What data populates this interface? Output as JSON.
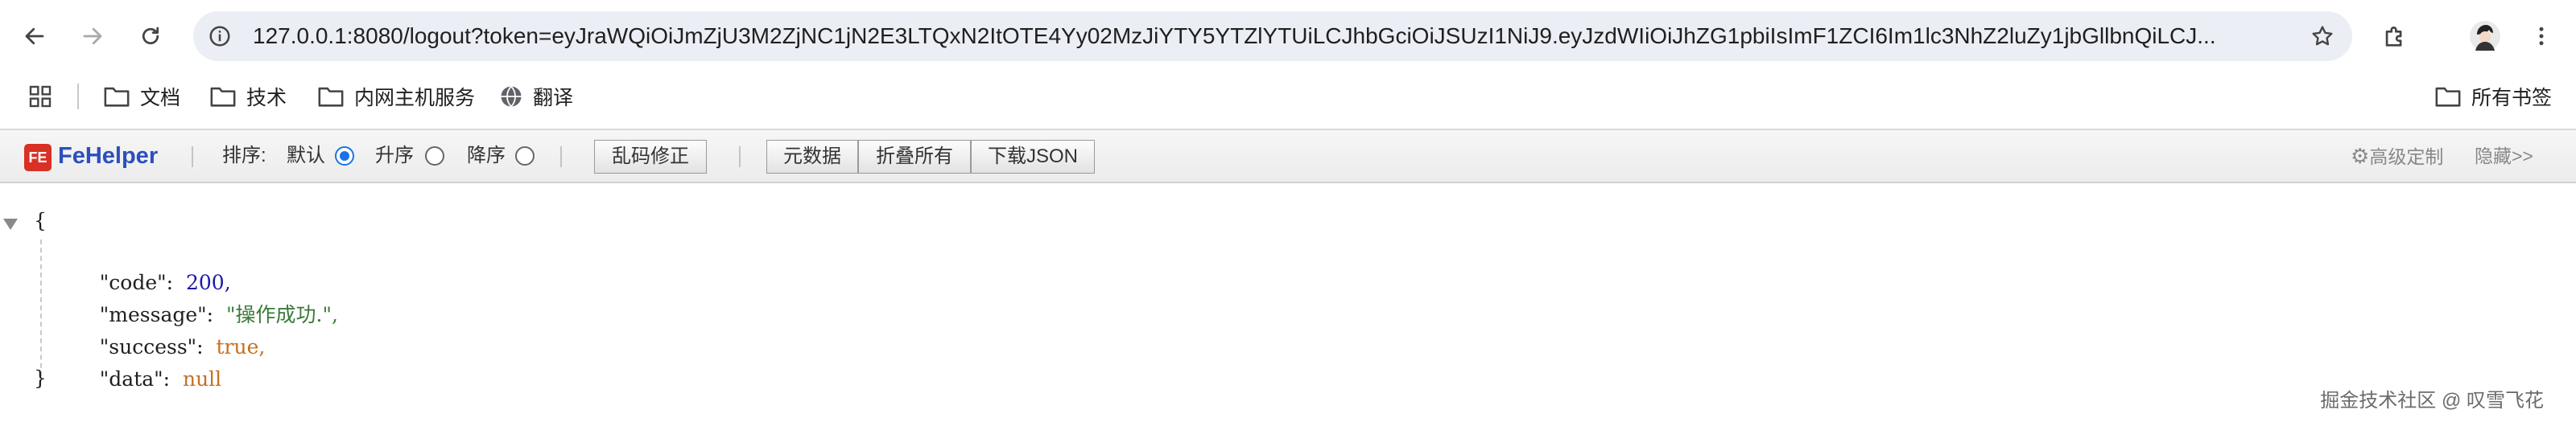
{
  "browser": {
    "url": "127.0.0.1:8080/logout?token=eyJraWQiOiJmZjU3M2ZjNC1jN2E3LTQxN2ItOTE4Yy02MzJiYTY5YTZlYTUiLCJhbGciOiJSUzI1NiJ9.eyJzdWIiOiJhZG1pbiIsImF1ZCI6Im1lc3NhZ2luZy1jbGllbnQiLCJ..."
  },
  "bookmarks": {
    "items": [
      {
        "label": "文档",
        "icon": "folder-icon"
      },
      {
        "label": "技术",
        "icon": "folder-icon"
      },
      {
        "label": "内网主机服务",
        "icon": "folder-icon"
      },
      {
        "label": "翻译",
        "icon": "globe-icon"
      }
    ],
    "all_label": "所有书签"
  },
  "fehelper": {
    "title": "FeHelper",
    "logo_text": "FE",
    "sort_label": "排序:",
    "sort_options": [
      {
        "label": "默认",
        "selected": true
      },
      {
        "label": "升序",
        "selected": false
      },
      {
        "label": "降序",
        "selected": false
      }
    ],
    "fix_encoding_label": "乱码修正",
    "raw_label": "元数据",
    "collapse_all_label": "折叠所有",
    "download_label": "下载JSON",
    "advanced_label": "高级定制",
    "hide_label": "隐藏>>"
  },
  "json": {
    "open_brace": "{",
    "close_brace": "}",
    "rows": [
      {
        "key": "\"code\":",
        "value": "200,",
        "type": "number"
      },
      {
        "key": "\"message\":",
        "value": "\"操作成功.\",",
        "type": "string"
      },
      {
        "key": "\"success\":",
        "value": "true,",
        "type": "boolean"
      },
      {
        "key": "\"data\":",
        "value": "null",
        "type": "null"
      }
    ]
  },
  "watermark": "掘金技术社区 @ 叹雪飞花",
  "colors": {
    "accent": "#1a73e8",
    "fehelper_title": "#2b4fbd",
    "json_number": "#1a1aa6",
    "json_string": "#3a7a3a",
    "json_literal": "#c5701d"
  }
}
